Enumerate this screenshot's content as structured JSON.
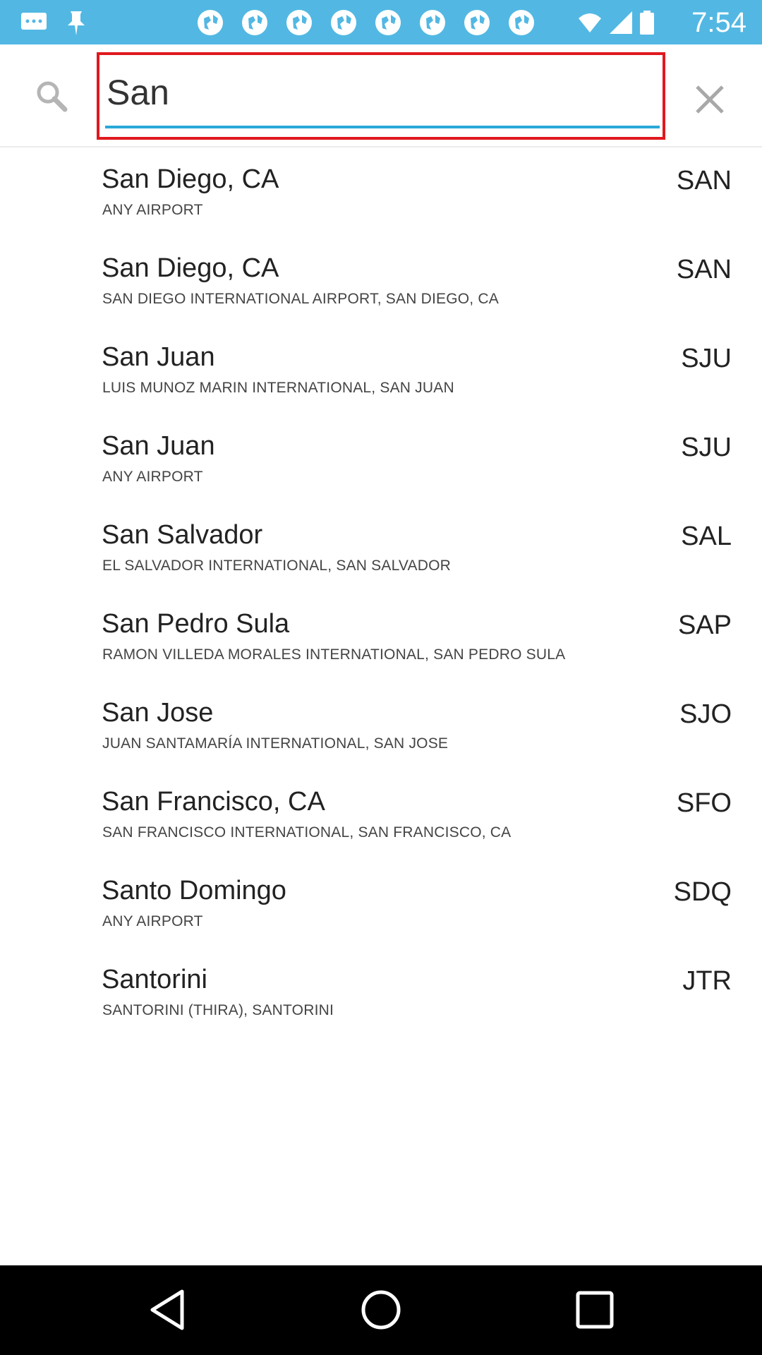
{
  "status_bar": {
    "time": "7:54",
    "notification_icons": [
      "chat-icon",
      "pin-icon",
      "globe-icon",
      "globe-icon",
      "globe-icon",
      "globe-icon",
      "globe-icon",
      "globe-icon",
      "globe-icon",
      "globe-icon",
      "globe-icon"
    ],
    "system_icons": [
      "alarm-icon",
      "wifi-icon",
      "signal-icon",
      "battery-icon"
    ]
  },
  "search": {
    "value": "San",
    "accent_color": "#29a8d8",
    "highlight_color": "#e0191f"
  },
  "results": [
    {
      "city": "San Diego, CA",
      "airport": "ANY AIRPORT",
      "code": "SAN"
    },
    {
      "city": "San Diego, CA",
      "airport": "SAN DIEGO INTERNATIONAL AIRPORT, SAN DIEGO, CA",
      "code": "SAN"
    },
    {
      "city": "San Juan",
      "airport": "LUIS MUNOZ MARIN INTERNATIONAL, SAN JUAN",
      "code": "SJU"
    },
    {
      "city": "San Juan",
      "airport": "ANY AIRPORT",
      "code": "SJU"
    },
    {
      "city": "San Salvador",
      "airport": "EL SALVADOR INTERNATIONAL, SAN SALVADOR",
      "code": "SAL"
    },
    {
      "city": "San Pedro Sula",
      "airport": "RAMON VILLEDA MORALES INTERNATIONAL, SAN PEDRO SULA",
      "code": "SAP"
    },
    {
      "city": "San Jose",
      "airport": "JUAN SANTAMARÍA INTERNATIONAL, SAN JOSE",
      "code": "SJO"
    },
    {
      "city": "San Francisco, CA",
      "airport": "SAN FRANCISCO INTERNATIONAL, SAN FRANCISCO, CA",
      "code": "SFO"
    },
    {
      "city": "Santo Domingo",
      "airport": "ANY AIRPORT",
      "code": "SDQ"
    },
    {
      "city": "Santorini",
      "airport": "SANTORINI (THIRA), SANTORINI",
      "code": "JTR"
    }
  ],
  "nav_bar": {
    "buttons": [
      "back-icon",
      "home-icon",
      "recents-icon"
    ]
  }
}
